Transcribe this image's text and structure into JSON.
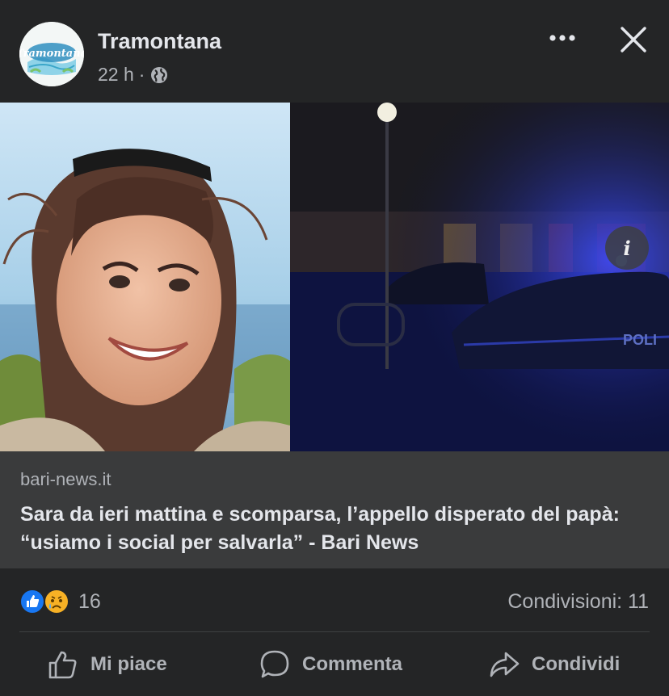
{
  "post": {
    "page_name": "Tramontana",
    "avatar_text": "Tramontana",
    "time": "22 h",
    "separator": "·",
    "audience_icon": "globe-icon",
    "more_icon": "more-dots-icon",
    "close_icon": "close-icon"
  },
  "media": {
    "info_icon": "info-icon",
    "info_label": "i",
    "car_lettering": "POLI"
  },
  "link": {
    "domain": "bari-news.it",
    "title": "Sara da ieri mattina e scomparsa, l’appello disperato del papà: “usiamo i social per salvarla” - Bari News"
  },
  "reactions": {
    "icons": [
      "like-reaction-icon",
      "sad-reaction-icon"
    ],
    "count": "16",
    "shares": "Condivisioni: 11"
  },
  "actions": {
    "like": "Mi piace",
    "comment": "Commenta",
    "share": "Condividi"
  },
  "colors": {
    "background": "#242526",
    "link_box": "#3a3b3c",
    "primary_text": "#e4e6eb",
    "secondary_text": "#b0b3b8",
    "like_blue": "#1877f2",
    "sad_yellow": "#f7b125"
  }
}
